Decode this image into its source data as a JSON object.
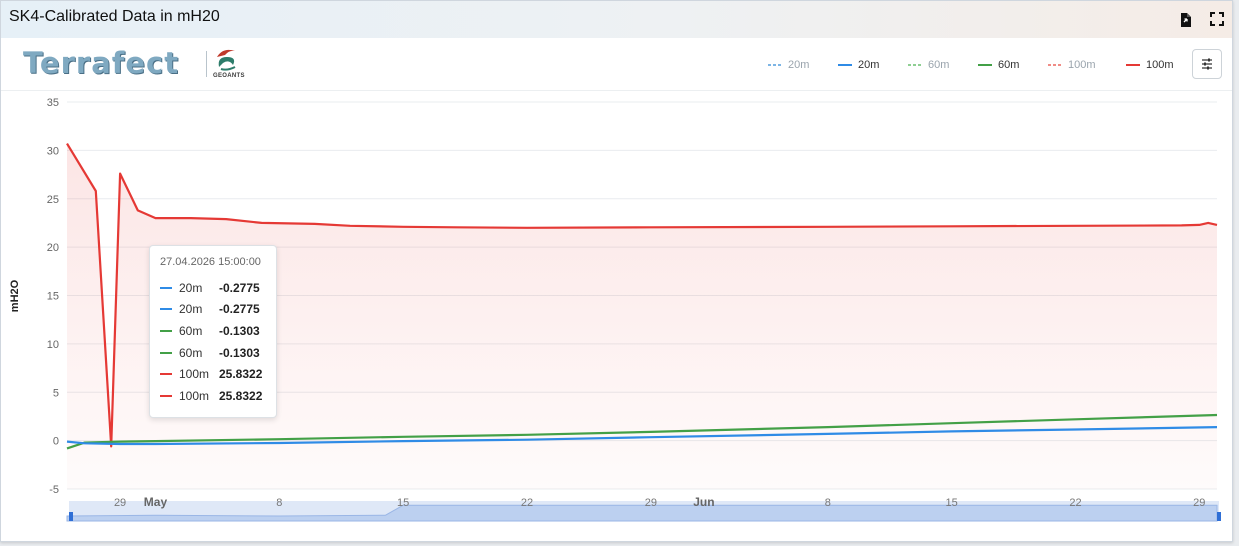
{
  "card": {
    "title": "SK4-Calibrated Data in mH20",
    "export_icon": "file-export-icon",
    "fullscreen_icon": "fullscreen-icon"
  },
  "brand": {
    "name": "Terrafect",
    "partner": "GEOANTS",
    "partner_icon": "geoants-logo-icon"
  },
  "legend": [
    {
      "label": "20m",
      "color": "#7db5e5",
      "style": "dashed",
      "faded": true
    },
    {
      "label": "20m",
      "color": "#2f8be6",
      "style": "solid",
      "faded": false
    },
    {
      "label": "60m",
      "color": "#8fcf93",
      "style": "dashed",
      "faded": true
    },
    {
      "label": "60m",
      "color": "#43a047",
      "style": "solid",
      "faded": false
    },
    {
      "label": "100m",
      "color": "#f08c86",
      "style": "dashed",
      "faded": true
    },
    {
      "label": "100m",
      "color": "#e53935",
      "style": "solid",
      "faded": false
    }
  ],
  "settings_icon": "sliders-icon",
  "tooltip": {
    "date": "27.04.2026 15:00:00",
    "rows": [
      {
        "name": "20m",
        "value": "-0.2775",
        "color": "#2f8be6"
      },
      {
        "name": "20m",
        "value": "-0.2775",
        "color": "#2f8be6"
      },
      {
        "name": "60m",
        "value": "-0.1303",
        "color": "#43a047"
      },
      {
        "name": "60m",
        "value": "-0.1303",
        "color": "#43a047"
      },
      {
        "name": "100m",
        "value": "25.8322",
        "color": "#e53935"
      },
      {
        "name": "100m",
        "value": "25.8322",
        "color": "#e53935"
      }
    ]
  },
  "chart_data": {
    "type": "line",
    "ylabel": "mH2O",
    "ylim": [
      -5,
      35
    ],
    "yticks": [
      -5,
      0,
      5,
      10,
      15,
      20,
      25,
      30,
      35
    ],
    "xlim": [
      "2026-04-26",
      "2026-06-30"
    ],
    "xticks": [
      {
        "label": "29",
        "date": "2026-04-29",
        "bold": false
      },
      {
        "label": "May",
        "date": "2026-05-01",
        "bold": true
      },
      {
        "label": "8",
        "date": "2026-05-08",
        "bold": false
      },
      {
        "label": "15",
        "date": "2026-05-15",
        "bold": false
      },
      {
        "label": "22",
        "date": "2026-05-22",
        "bold": false
      },
      {
        "label": "29",
        "date": "2026-05-29",
        "bold": false
      },
      {
        "label": "Jun",
        "date": "2026-06-01",
        "bold": true
      },
      {
        "label": "8",
        "date": "2026-06-08",
        "bold": false
      },
      {
        "label": "15",
        "date": "2026-06-15",
        "bold": false
      },
      {
        "label": "22",
        "date": "2026-06-22",
        "bold": false
      },
      {
        "label": "29",
        "date": "2026-06-29",
        "bold": false
      }
    ],
    "grid": true,
    "legend_position": "top-right",
    "series": [
      {
        "name": "100m",
        "color": "#e53935",
        "fill": true,
        "x": [
          "2026-04-26",
          "2026-04-27 15:00",
          "2026-04-28 12:00",
          "2026-04-29",
          "2026-04-30",
          "2026-05-01",
          "2026-05-03",
          "2026-05-05",
          "2026-05-07",
          "2026-05-10",
          "2026-05-12",
          "2026-05-15",
          "2026-05-18",
          "2026-05-22",
          "2026-05-29",
          "2026-06-08",
          "2026-06-15",
          "2026-06-22",
          "2026-06-28",
          "2026-06-29",
          "2026-06-29 12:00",
          "2026-06-30"
        ],
        "y": [
          30.7,
          25.8,
          -0.6,
          27.6,
          23.8,
          23.0,
          23.0,
          22.9,
          22.5,
          22.4,
          22.2,
          22.1,
          22.05,
          22.0,
          22.05,
          22.1,
          22.15,
          22.2,
          22.25,
          22.3,
          22.5,
          22.3
        ]
      },
      {
        "name": "60m",
        "color": "#43a047",
        "fill": false,
        "x": [
          "2026-04-26",
          "2026-04-27",
          "2026-04-29",
          "2026-05-01",
          "2026-05-08",
          "2026-05-15",
          "2026-05-22",
          "2026-05-29",
          "2026-06-08",
          "2026-06-15",
          "2026-06-22",
          "2026-06-30"
        ],
        "y": [
          -0.8,
          -0.2,
          -0.1,
          -0.05,
          0.15,
          0.4,
          0.6,
          0.9,
          1.4,
          1.8,
          2.2,
          2.65
        ]
      },
      {
        "name": "20m",
        "color": "#2f8be6",
        "fill": false,
        "x": [
          "2026-04-26",
          "2026-04-27",
          "2026-04-29",
          "2026-05-01",
          "2026-05-08",
          "2026-05-15",
          "2026-05-22",
          "2026-05-29",
          "2026-06-08",
          "2026-06-15",
          "2026-06-22",
          "2026-06-30"
        ],
        "y": [
          -0.1,
          -0.28,
          -0.35,
          -0.35,
          -0.25,
          -0.05,
          0.1,
          0.35,
          0.7,
          0.95,
          1.15,
          1.4
        ]
      }
    ],
    "navigator": {
      "x": [
        "2026-04-26",
        "2026-05-01",
        "2026-05-08",
        "2026-05-14",
        "2026-05-15",
        "2026-06-30"
      ],
      "y": [
        0.3,
        0.35,
        0.3,
        0.35,
        0.95,
        0.95
      ]
    }
  }
}
